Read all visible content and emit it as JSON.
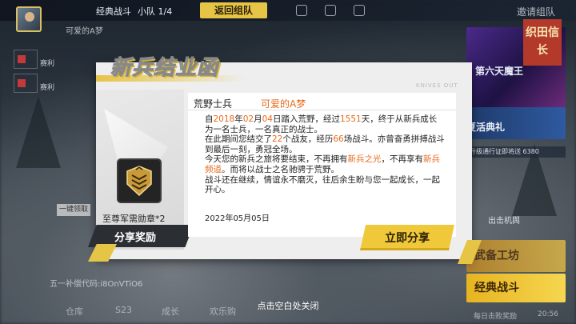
{
  "topbar": {
    "mode": "经典战斗",
    "team": "小队 1/4",
    "return_button": "返回组队",
    "invite": "邀请组队"
  },
  "player": {
    "name": "可爱的A梦"
  },
  "left_menu": {
    "item1": "赛利",
    "item2": "赛利",
    "claim_button": "一键领取"
  },
  "right_panel": {
    "promo_title": "第六天魔王",
    "promo_badge": "织田信长",
    "promo_sub": "夏活典礼",
    "promo_strip": "升级通行证即将送 6380",
    "side_label": "出击机舆",
    "workshop": "武备工坊",
    "classic_battle": "经典战斗"
  },
  "bottom": {
    "notice": "五一补偿代码:i8OnVTiO6",
    "nav": [
      "仓库",
      "S23",
      "成长",
      "欢乐购"
    ],
    "daily": "每日击败奖励",
    "clock": "20:56",
    "close_hint": "点击空白处关闭"
  },
  "certificate": {
    "title": "新兵结业函",
    "brand": "KNIVES OUT",
    "rank": "荒野士兵",
    "player_name": "可爱的A梦",
    "para1_a": "自",
    "year": "2018",
    "para1_b": "年",
    "month": "02",
    "para1_c": "月",
    "day": "04",
    "para1_d": "日踏入荒野，经过",
    "days": "1551",
    "para1_e": "天，终于从新兵成长为一名士兵，一名真正的战士。",
    "para2_a": "在此期间您结交了",
    "friends": "22",
    "para2_b": "个战友，经历",
    "battles": "66",
    "para2_c": "场战斗。亦曾奋勇拼搏战斗到最后一刻，勇冠全场。",
    "para3_a": "今天您的新兵之旅将要结束，不再拥有",
    "hl1": "新兵之光",
    "para3_b": "，不再享有",
    "hl2": "新兵频道",
    "para3_c": "。而将以战士之名驰骋于荒野。",
    "para4": "战斗还在继续，情谊永不磨灭，往后余生盼与您一起成长，一起开心。",
    "date": "2022年05月05日",
    "reward_name": "至尊军需勋章*2",
    "share_reward": "分享奖励",
    "share_now": "立即分享"
  },
  "colors": {
    "accent_yellow": "#f0c93b",
    "highlight_orange": "#e86a1a"
  }
}
